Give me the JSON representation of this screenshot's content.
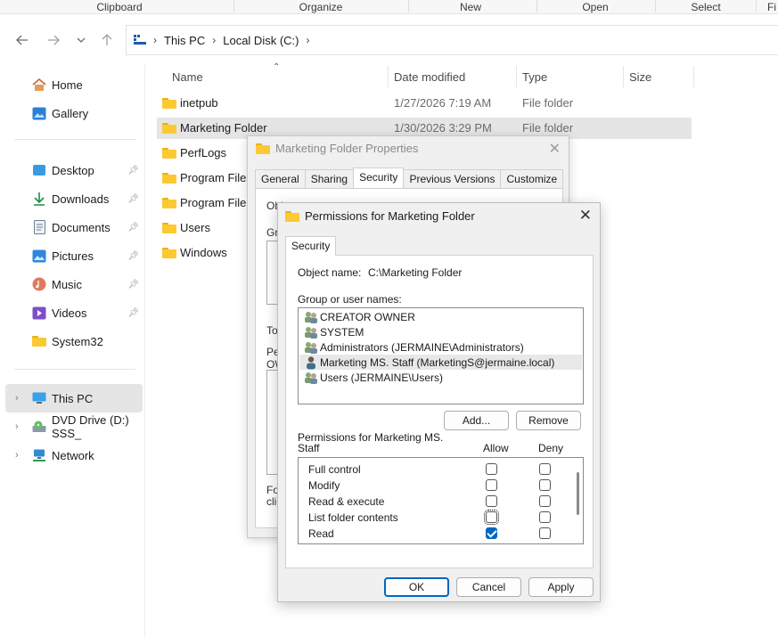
{
  "ribbon": {
    "groups": [
      "Clipboard",
      "Organize",
      "New",
      "Open",
      "Select",
      "Fi"
    ]
  },
  "nav": {
    "back_icon": "arrow-left-icon",
    "forward_icon": "arrow-right-icon",
    "recent_icon": "chevron-down-icon",
    "up_icon": "arrow-up-icon",
    "breadcrumb": [
      "This PC",
      "Local Disk (C:)"
    ]
  },
  "sidebar": {
    "items": [
      {
        "label": "Home",
        "icon": "home-icon"
      },
      {
        "label": "Gallery",
        "icon": "gallery-icon"
      },
      {
        "label": "Desktop",
        "icon": "desktop-icon",
        "pinned": true
      },
      {
        "label": "Downloads",
        "icon": "download-icon",
        "pinned": true
      },
      {
        "label": "Documents",
        "icon": "documents-icon",
        "pinned": true
      },
      {
        "label": "Pictures",
        "icon": "pictures-icon",
        "pinned": true
      },
      {
        "label": "Music",
        "icon": "music-icon",
        "pinned": true
      },
      {
        "label": "Videos",
        "icon": "videos-icon",
        "pinned": true
      },
      {
        "label": "System32",
        "icon": "folder-icon"
      },
      {
        "label": "This PC",
        "icon": "this-pc-icon",
        "selected": true
      },
      {
        "label": "DVD Drive (D:) SSS_",
        "icon": "dvd-drive-icon"
      },
      {
        "label": "Network",
        "icon": "network-icon"
      }
    ]
  },
  "filelist": {
    "columns": {
      "name": "Name",
      "date": "Date modified",
      "type": "Type",
      "size": "Size"
    },
    "rows": [
      {
        "name": "inetpub",
        "date": "1/27/2026 7:19 AM",
        "type": "File folder"
      },
      {
        "name": "Marketing Folder",
        "date": "1/30/2026 3:29 PM",
        "type": "File folder",
        "selected": true
      },
      {
        "name": "PerfLogs",
        "date": "",
        "type": ""
      },
      {
        "name": "Program Files",
        "date": "",
        "type": ""
      },
      {
        "name": "Program Files",
        "date": "",
        "type": ""
      },
      {
        "name": "Users",
        "date": "",
        "type": ""
      },
      {
        "name": "Windows",
        "date": "",
        "type": ""
      }
    ]
  },
  "properties_dialog": {
    "title": "Marketing Folder Properties",
    "tabs": [
      "General",
      "Sharing",
      "Security",
      "Previous Versions",
      "Customize"
    ],
    "active_tab": "Security",
    "fragments": {
      "object": "Object name:",
      "object_value": "C:\\Marketing Folder",
      "group": "Gro",
      "to": "To",
      "pe": "Pe",
      "ow": "OW",
      "for": "For",
      "cli": "clic"
    }
  },
  "permissions_dialog": {
    "title": "Permissions for Marketing Folder",
    "tab": "Security",
    "object_label": "Object name:",
    "object_value": "C:\\Marketing Folder",
    "group_label": "Group or user names:",
    "users": [
      {
        "name": "CREATOR OWNER",
        "icon": "group-icon"
      },
      {
        "name": "SYSTEM",
        "icon": "group-icon"
      },
      {
        "name": "Administrators (JERMAINE\\Administrators)",
        "icon": "group-icon"
      },
      {
        "name": "Marketing MS. Staff (MarketingS@jermaine.local)",
        "icon": "user-icon",
        "selected": true
      },
      {
        "name": "Users (JERMAINE\\Users)",
        "icon": "group-icon"
      }
    ],
    "add_label": "Add...",
    "remove_label": "Remove",
    "perms_label_line1": "Permissions for Marketing MS.",
    "perms_label_line2": "Staff",
    "allow_label": "Allow",
    "deny_label": "Deny",
    "permissions": [
      {
        "name": "Full control",
        "allow": false,
        "deny": false
      },
      {
        "name": "Modify",
        "allow": false,
        "deny": false
      },
      {
        "name": "Read & execute",
        "allow": false,
        "deny": false
      },
      {
        "name": "List folder contents",
        "allow": false,
        "deny": false,
        "focused": true
      },
      {
        "name": "Read",
        "allow": true,
        "deny": false
      }
    ],
    "ok_label": "OK",
    "cancel_label": "Cancel",
    "apply_label": "Apply",
    "accent": "#0067c0"
  }
}
